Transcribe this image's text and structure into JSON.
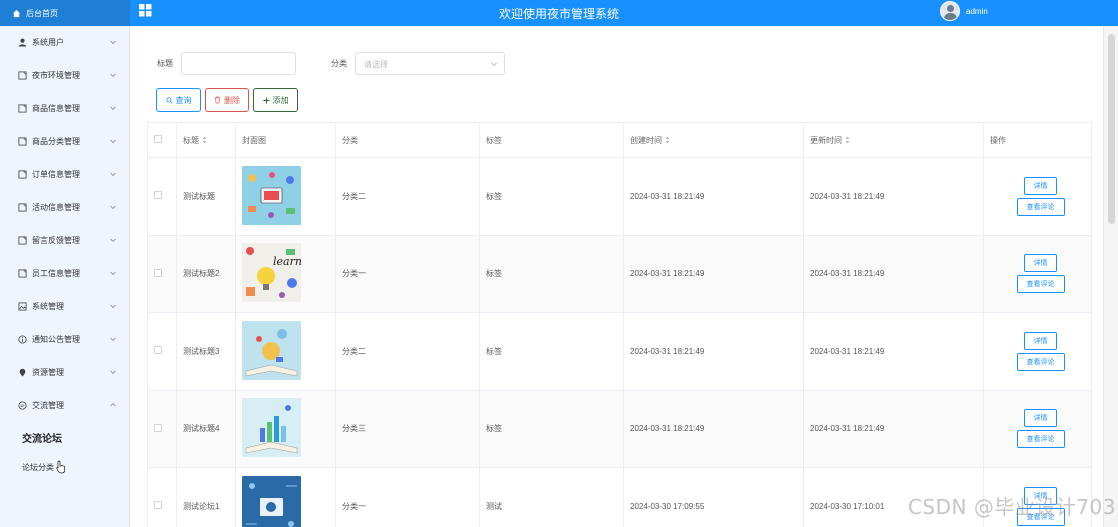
{
  "header": {
    "brand": "后台首页",
    "title": "欢迎使用夜市管理系统",
    "user_name": "admin",
    "bg_color": "#1890ff"
  },
  "sidebar": {
    "items": [
      {
        "label": "系统用户",
        "icon": "user-icon"
      },
      {
        "label": "夜市环境管理",
        "icon": "doc-icon"
      },
      {
        "label": "商品信息管理",
        "icon": "doc-icon"
      },
      {
        "label": "商品分类管理",
        "icon": "doc-icon"
      },
      {
        "label": "订单信息管理",
        "icon": "doc-icon"
      },
      {
        "label": "活动信息管理",
        "icon": "doc-icon"
      },
      {
        "label": "留言反馈管理",
        "icon": "doc-icon"
      },
      {
        "label": "员工信息管理",
        "icon": "doc-icon"
      },
      {
        "label": "系统管理",
        "icon": "image-icon"
      },
      {
        "label": "通知公告管理",
        "icon": "info-icon"
      },
      {
        "label": "资源管理",
        "icon": "location-icon"
      },
      {
        "label": "交流管理",
        "icon": "chat-icon"
      }
    ],
    "sub_items": [
      "交流论坛",
      "论坛分类"
    ]
  },
  "search": {
    "title_label": "标题",
    "category_label": "分类",
    "category_placeholder": "请选择"
  },
  "buttons": {
    "search": "查询",
    "delete": "删除",
    "add": "添加"
  },
  "table": {
    "headers": [
      "标题",
      "封面图",
      "分类",
      "标签",
      "创建时间",
      "更新时间",
      "操作"
    ],
    "detail_label": "详情",
    "review_label": "查看评论",
    "rows": [
      {
        "title": "测试标题",
        "category": "分类二",
        "tag": "标签",
        "created": "2024-03-31 18:21:49",
        "updated": "2024-03-31 18:21:49"
      },
      {
        "title": "测试标题2",
        "category": "分类一",
        "tag": "标签",
        "created": "2024-03-31 18:21:49",
        "updated": "2024-03-31 18:21:49"
      },
      {
        "title": "测试标题3",
        "category": "分类二",
        "tag": "标签",
        "created": "2024-03-31 18:21:49",
        "updated": "2024-03-31 18:21:49"
      },
      {
        "title": "测试标题4",
        "category": "分类三",
        "tag": "标签",
        "created": "2024-03-31 18:21:49",
        "updated": "2024-03-31 18:21:49"
      },
      {
        "title": "测试论坛1",
        "category": "分类一",
        "tag": "测试",
        "created": "2024-03-30 17:09:55",
        "updated": "2024-03-30 17:10:01"
      }
    ]
  },
  "watermark": "CSDN @毕业设计703"
}
